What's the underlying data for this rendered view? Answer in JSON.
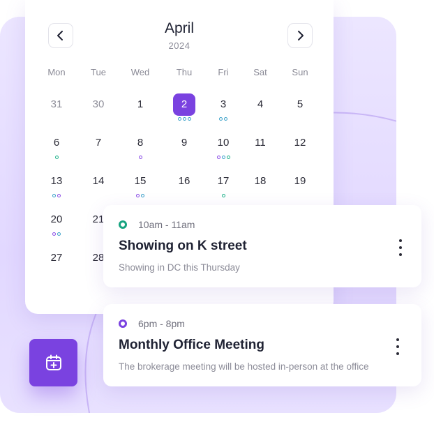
{
  "calendar": {
    "month": "April",
    "year": "2024",
    "weekdays": [
      "Mon",
      "Tue",
      "Wed",
      "Thu",
      "Fri",
      "Sat",
      "Sun"
    ],
    "selected_day": "2",
    "weeks": [
      [
        {
          "d": "31",
          "muted": true
        },
        {
          "d": "30",
          "muted": true
        },
        {
          "d": "1"
        },
        {
          "d": "2",
          "selected": true,
          "dots": [
            "teal",
            "teal",
            "teal"
          ]
        },
        {
          "d": "3",
          "dots": [
            "teal",
            "teal"
          ]
        },
        {
          "d": "4"
        },
        {
          "d": "5"
        }
      ],
      [
        {
          "d": "6",
          "dots": [
            "green"
          ]
        },
        {
          "d": "7"
        },
        {
          "d": "8",
          "dots": [
            "purple"
          ]
        },
        {
          "d": "9"
        },
        {
          "d": "10",
          "dots": [
            "purple",
            "teal",
            "green"
          ]
        },
        {
          "d": "11"
        },
        {
          "d": "12"
        }
      ],
      [
        {
          "d": "13",
          "dots": [
            "teal",
            "purple"
          ]
        },
        {
          "d": "14"
        },
        {
          "d": "15",
          "dots": [
            "purple",
            "teal"
          ]
        },
        {
          "d": "16"
        },
        {
          "d": "17",
          "dots": [
            "green"
          ]
        },
        {
          "d": "18"
        },
        {
          "d": "19"
        }
      ],
      [
        {
          "d": "20",
          "dots": [
            "purple",
            "teal"
          ]
        },
        {
          "d": "21"
        }
      ],
      [
        {
          "d": "27"
        },
        {
          "d": "28"
        }
      ]
    ]
  },
  "events": [
    {
      "time": "10am - 11am",
      "title": "Showing on K street",
      "description": "Showing in DC this Thursday",
      "status_color": "#16a37f"
    },
    {
      "time": "6pm - 8pm",
      "title": "Monthly Office Meeting",
      "description": "The brokerage meeting will be hosted in-person at the office",
      "status_color": "#7a42e0"
    }
  ],
  "colors": {
    "accent": "#7a42e0",
    "dot_teal": "#3aa0c8",
    "dot_green": "#1fb38a",
    "dot_purple": "#8a4ce6"
  },
  "icons": {
    "prev": "chevron-left-icon",
    "next": "chevron-right-icon",
    "add_event": "calendar-add-icon",
    "more": "kebab-menu-icon"
  }
}
